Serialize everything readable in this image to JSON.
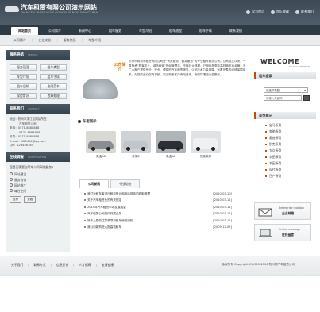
{
  "header": {
    "logo_text": "汽车租赁有限公司演示网站",
    "logo_sub": "QICHEZULIN YOUXIAN GONGSI YANSHI WANGZHAN",
    "top_links": [
      "设为首页",
      "加入收藏",
      "联系我们"
    ]
  },
  "nav": {
    "tabs": [
      "网站首页",
      "公司简介",
      "新闻中心",
      "租车服务",
      "车型介绍",
      "租车流程",
      "租车手续",
      "联系我们"
    ]
  },
  "subnav": [
    "公司简介",
    "企业文化",
    "服务信息",
    "车型介绍"
  ],
  "left": {
    "services_title": "服务导航",
    "services_title_en": "SERVICE",
    "services": [
      "服务范围",
      "租车类型",
      "车型介绍",
      "租车手续",
      "租车须知",
      "合同范本",
      "保险常识",
      "违章处理"
    ],
    "contact_title": "联系我们",
    "contact_title_en": "CONTACT",
    "contact_lines": [
      "地址：杭州市滨江区网站所在",
      "汽车租赁公司",
      "电话：0571-8888888",
      "0571-8888888",
      "传真：0571-8888888",
      "E-mail：123456@qq.com",
      "QQ：123456789"
    ],
    "poll_title": "在线调查",
    "poll_title_en": "INVESTIGATION",
    "poll_question": "您是否需要自驾车公司网站服务?",
    "poll_options": [
      "网站建设",
      "服务咨询",
      "网站推广",
      "域名空间"
    ],
    "poll_vote": "投票",
    "poll_view": "查看"
  },
  "about": {
    "badge": "公司简介",
    "text": "杭州市网页车租赁有限公司是“贵宾服务、微笑服务”的专业租车服务公司。公司成立以来，一直秉承“顾客至上，诚信经营”的经营理念，不断壮大规模，已拥有各类中高档轿车百余辆，为广大客户提供专业、安全、便捷的汽车租赁服务。公司技术力量雄厚，有着完善的维修保障体系，为您的出行保驾护航。欢迎新老客户来电咨询，我们将竭诚为您服务。"
  },
  "cars": {
    "title": "车型展示",
    "items": [
      "奥迪A6",
      "奔驰E",
      "奥迪A8",
      "别克商务"
    ]
  },
  "news": {
    "tabs": [
      "公司新闻",
      "行业动态"
    ],
    "rows": [
      {
        "title": "我们对租车者进行租前登记和租后押金的收取管理",
        "date": "[2010-03-10]"
      },
      {
        "title": "关于汽车租赁业的有关规定",
        "date": "[2010-03-11]"
      },
      {
        "title": "2010年汽车租赁市场发展展望",
        "date": "[2010-03-11]"
      },
      {
        "title": "汽车租赁公司如何开展业务",
        "date": "[2010-03-11]"
      },
      {
        "title": "新车上路的注意事项和租车使用须知",
        "date": "[2010-03-11]"
      },
      {
        "title": "我公司新购进大批高档轿车",
        "date": "[2009-12-09]"
      }
    ]
  },
  "right": {
    "welcome": "WELCOME",
    "welcome_sub": "to our website",
    "search_title": "租车搜索",
    "search_select": "请选择车型",
    "search_placeholder": "请输入关键词",
    "types_title": "车型展示",
    "types": [
      "宝马系列",
      "奔驰系列",
      "奥迪系列",
      "别克系列",
      "大众系列",
      "丰田系列",
      "本田系列",
      "现代系列",
      "日产系列"
    ],
    "promo1_top": "Enterprise mailbox",
    "promo1_label": "企业邮箱",
    "promo2_top": "Online message",
    "promo2_label": "在线留言"
  },
  "footer": {
    "links": [
      "关于我们",
      "联系方式",
      "信息反馈",
      "人才招聘",
      "友情链接"
    ],
    "copyright": "版权所有 Copyright(C)2009-2010 杭州某汽车租赁公司"
  }
}
